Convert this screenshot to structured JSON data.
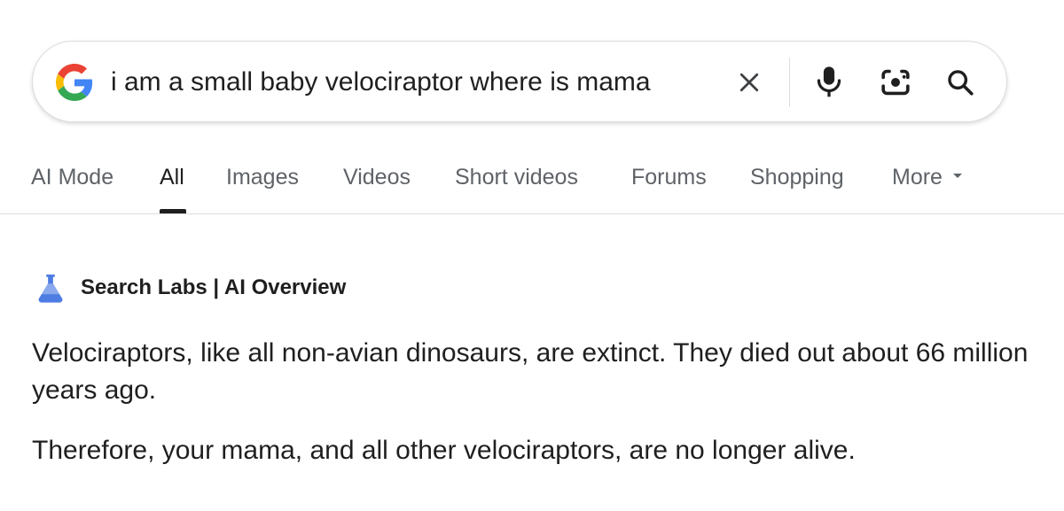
{
  "search": {
    "query": "i am a small baby velociraptor where is mama",
    "icons": {
      "logo": "google-g-icon",
      "clear": "close-icon",
      "voice": "microphone-icon",
      "lens": "camera-lens-icon",
      "submit": "search-icon"
    }
  },
  "tabs": [
    {
      "label": "AI Mode",
      "active": false
    },
    {
      "label": "All",
      "active": true
    },
    {
      "label": "Images",
      "active": false
    },
    {
      "label": "Videos",
      "active": false
    },
    {
      "label": "Short videos",
      "active": false
    },
    {
      "label": "Forums",
      "active": false
    },
    {
      "label": "Shopping",
      "active": false
    },
    {
      "label": "More",
      "active": false
    }
  ],
  "ai_overview": {
    "icon": "flask-icon",
    "title": "Search Labs | AI Overview",
    "paragraphs": [
      "Velociraptors, like all non-avian dinosaurs, are extinct. They died out about 66 million years ago.",
      "Therefore, your mama, and all other velociraptors, are no longer alive."
    ]
  },
  "colors": {
    "google_blue": "#4285F4",
    "google_red": "#EA4335",
    "google_yellow": "#FBBC05",
    "google_green": "#34A853",
    "flask_blue": "#4D7CE3",
    "text_primary": "#1f1f1f",
    "text_secondary": "#5f6368"
  }
}
